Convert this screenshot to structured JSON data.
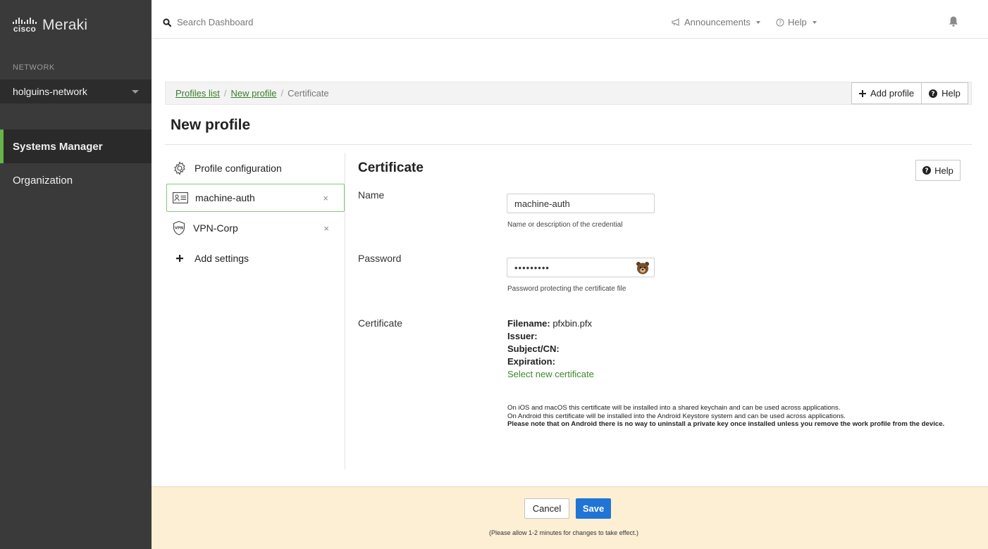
{
  "brand": {
    "cisco": "cisco",
    "product": "Meraki"
  },
  "sidebar": {
    "network_heading": "NETWORK",
    "network_name": "holguins-network",
    "items": [
      {
        "label": "Systems Manager",
        "active": true
      },
      {
        "label": "Organization",
        "active": false
      }
    ]
  },
  "topbar": {
    "search_placeholder": "Search Dashboard",
    "announcements": "Announcements",
    "help": "Help"
  },
  "breadcrumb": {
    "items": [
      "Profiles list",
      "New profile",
      "Certificate"
    ]
  },
  "toolbar": {
    "add_profile": "Add profile",
    "help": "Help"
  },
  "page": {
    "title": "New profile"
  },
  "profile_list": {
    "items": [
      {
        "label": "Profile configuration",
        "icon": "gear-icon",
        "removable": false
      },
      {
        "label": "machine-auth",
        "icon": "id-card-icon",
        "removable": true,
        "selected": true
      },
      {
        "label": "VPN-Corp",
        "icon": "vpn-shield-icon",
        "removable": true
      },
      {
        "label": "Add settings",
        "icon": "plus-icon",
        "removable": false
      }
    ],
    "remove_glyph": "×"
  },
  "form": {
    "section_title": "Certificate",
    "help": "Help",
    "name": {
      "label": "Name",
      "value": "machine-auth",
      "hint": "Name or description of the credential"
    },
    "password": {
      "label": "Password",
      "value": "•••••••••",
      "hint": "Password protecting the certificate file"
    },
    "certificate": {
      "label": "Certificate",
      "filename_label": "Filename:",
      "filename": "pfxbin.pfx",
      "issuer_label": "Issuer:",
      "subject_label": "Subject/CN:",
      "expiration_label": "Expiration:",
      "select_link": "Select new certificate"
    },
    "note": {
      "line1": "On iOS and macOS this certificate will be installed into a shared keychain and can be used across applications.",
      "line2": "On Android this certificate will be installed into the Android Keystore system and can be used across applications.",
      "line3": "Please note that on Android there is no way to uninstall a private key once installed unless you remove the work profile from the device."
    }
  },
  "footer": {
    "cancel": "Cancel",
    "save": "Save",
    "note": "(Please allow 1-2 minutes for changes to take effect.)"
  },
  "colors": {
    "sidebar_bg": "#3a3a3a",
    "accent_green": "#67b346",
    "link_green": "#3a8a28",
    "save_blue": "#1f74d6",
    "footer_bg": "#fcefd4"
  }
}
